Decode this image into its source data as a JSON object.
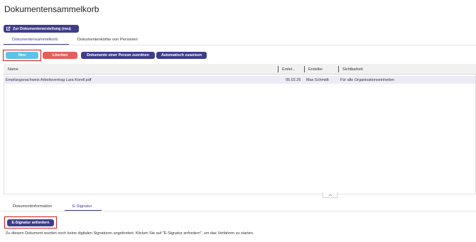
{
  "page": {
    "title": "Dokumentensammelkorb"
  },
  "toolbar_top": {
    "create_link_label": "Zur Dokumentenerstellung (neu)",
    "create_link_icon": "external-link-icon"
  },
  "tabs": [
    {
      "label": "Dokumentensammelkorb",
      "active": true
    },
    {
      "label": "Dokumentenkörbe von Personen",
      "active": false
    }
  ],
  "actions": {
    "new_label": "Neu",
    "delete_label": "Löschen",
    "assign_person_label": "Dokumente einer Person zuordnen",
    "auto_assign_label": "Automatisch zuweisen"
  },
  "table": {
    "columns": [
      "Name",
      "Erstel...",
      "Ersteller",
      "Sichtbarkeit"
    ],
    "rows": [
      {
        "name": "Empfangsnachweis Arbeitsvertrag Lara Korell.pdf",
        "created": "05.02.26",
        "creator": "Max Schmidt",
        "visibility": "Für alle Organisationseinheiten"
      }
    ]
  },
  "bottom_tabs": [
    {
      "label": "Dokumentinformation",
      "active": false
    },
    {
      "label": "E-Signatur",
      "active": true
    }
  ],
  "esignature": {
    "request_button_label": "E-Signatur anfordern",
    "info_text": "Zu diesem Dokument wurden noch keine digitalen Signaturen angefordert. Klicken Sie auf \"E-Signatur anfordern\", um das Verfahren zu starten."
  },
  "colors": {
    "primary": "#3f3d8a",
    "new": "#5ec3e6",
    "delete": "#e35f5d",
    "highlight": "#d11a1a",
    "selected_row": "#ececf8"
  }
}
